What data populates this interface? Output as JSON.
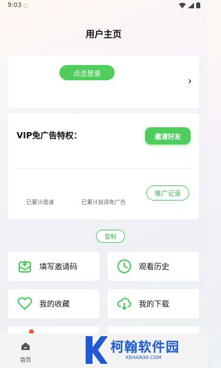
{
  "status_bar": {
    "time": "9:03"
  },
  "header": {
    "title": "用户主页"
  },
  "login": {
    "button_label": "点击登录"
  },
  "vip": {
    "title": "VIP免广告特权：",
    "invite_button": "邀请好友",
    "stat_invited": "已累计邀请",
    "stat_free": "已累计获得免广告",
    "promo_button": "推广记录"
  },
  "copy_button": "复制",
  "grid": {
    "items": [
      {
        "label": "填写邀请码",
        "icon": "envelope-download-icon"
      },
      {
        "label": "观看历史",
        "icon": "clock-icon"
      },
      {
        "label": "我的收藏",
        "icon": "heart-icon"
      },
      {
        "label": "我的下载",
        "icon": "cloud-download-icon"
      }
    ]
  },
  "nav": {
    "home_label": "首页"
  },
  "watermark": {
    "text": "柯翰软件园",
    "url": "KEHAN38.COM"
  },
  "colors": {
    "accent": "#4fce5d",
    "watermark": "#1e5ad1"
  }
}
